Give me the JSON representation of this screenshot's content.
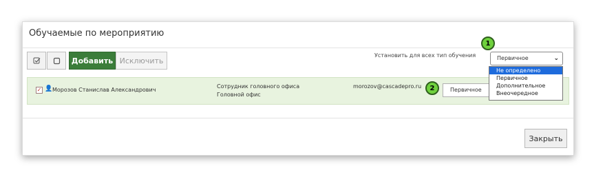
{
  "dialog": {
    "title": "Обучаемые по мероприятию",
    "toolbar": {
      "check_all_icon": "check-square-icon",
      "uncheck_icon": "square-icon",
      "add_label": "Добавить",
      "exclude_label": "Исключить"
    },
    "set_all": {
      "label": "Установить для всех тип обучения",
      "selected": "Первичное",
      "options": [
        "Не определено",
        "Первичное",
        "Дополнительное",
        "Внеочередное"
      ],
      "highlighted": "Не определено"
    },
    "rows": [
      {
        "checked": true,
        "name": "Морозов Станислав Александрович",
        "position": "Сотрудник головного офиса",
        "department": "Головной офис",
        "email": "morozov@cascadepro.ru",
        "training_type": "Первичное"
      }
    ],
    "close_label": "Закрыть"
  },
  "annotations": {
    "badge1": "1",
    "badge2": "2"
  },
  "colors": {
    "add_button": "#3b7d3a",
    "row_background": "#e8f3df",
    "dropdown_highlight": "#1e6bdc",
    "badge": "#6fd13d"
  }
}
